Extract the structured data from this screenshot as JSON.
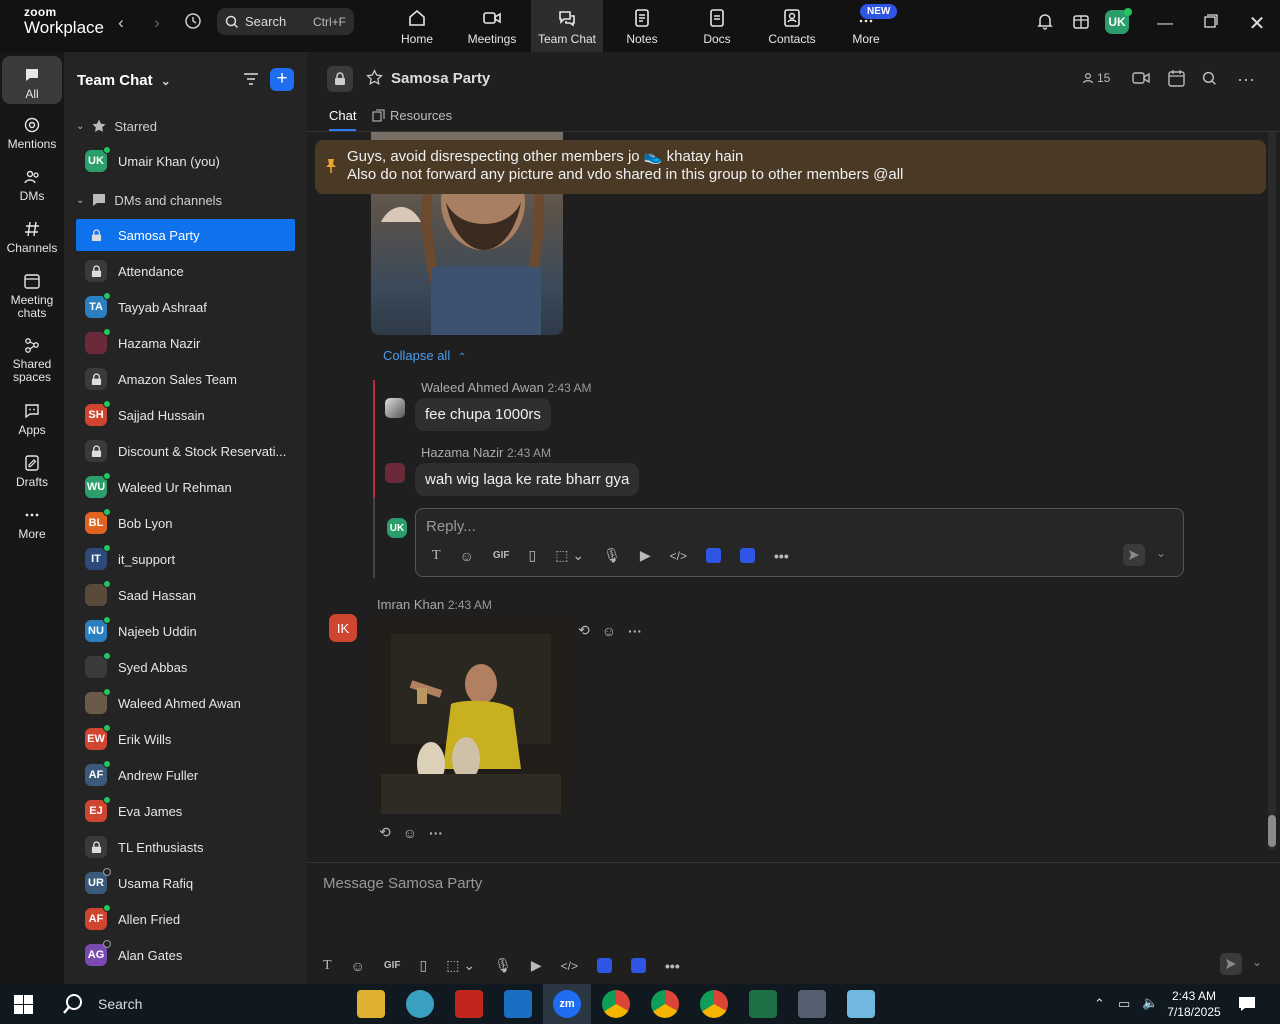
{
  "app": {
    "logo_top": "zoom",
    "logo_bottom": "Workplace"
  },
  "search": {
    "label": "Search",
    "shortcut": "Ctrl+F"
  },
  "top_tabs": [
    {
      "label": "Home"
    },
    {
      "label": "Meetings"
    },
    {
      "label": "Team Chat"
    },
    {
      "label": "Notes"
    },
    {
      "label": "Docs"
    },
    {
      "label": "Contacts"
    },
    {
      "label": "More"
    }
  ],
  "new_badge": "NEW",
  "user_avatar": "UK",
  "rail": [
    {
      "label": "All"
    },
    {
      "label": "Mentions"
    },
    {
      "label": "DMs"
    },
    {
      "label": "Channels"
    },
    {
      "label": "Meeting chats"
    },
    {
      "label": "Shared spaces"
    },
    {
      "label": "Apps"
    },
    {
      "label": "Drafts"
    },
    {
      "label": "More"
    }
  ],
  "sidebar": {
    "title": "Team Chat",
    "starred_label": "Starred",
    "starred_item": {
      "name": "Umair Khan (you)",
      "initials": "UK",
      "color": "#2b9e6b"
    },
    "dms_label": "DMs and channels",
    "items": [
      {
        "name": "Samosa Party",
        "type": "lock",
        "active": true
      },
      {
        "name": "Attendance",
        "type": "lock"
      },
      {
        "name": "Tayyab Ashraaf",
        "initials": "TA",
        "color": "#2b7fc1",
        "online": true
      },
      {
        "name": "Hazama Nazir",
        "initials": "",
        "color": "#6b2a3a",
        "online": true
      },
      {
        "name": "Amazon Sales Team",
        "type": "lock"
      },
      {
        "name": "Sajjad Hussain",
        "initials": "SH",
        "color": "#d0452f",
        "online": true
      },
      {
        "name": "Discount & Stock Reservati...",
        "type": "lock"
      },
      {
        "name": "Waleed Ur Rehman",
        "initials": "WU",
        "color": "#2b9e6b",
        "online": true
      },
      {
        "name": "Bob Lyon",
        "initials": "BL",
        "color": "#e0631f",
        "online": true
      },
      {
        "name": "it_support",
        "initials": "IT",
        "color": "#2c4a7a",
        "online": true
      },
      {
        "name": "Saad Hassan",
        "initials": "",
        "color": "#5a4a3a",
        "online": true
      },
      {
        "name": "Najeeb Uddin",
        "initials": "NU",
        "color": "#2b7fc1",
        "online": true
      },
      {
        "name": "Syed Abbas",
        "initials": "",
        "color": "#3a3a3a",
        "online": true
      },
      {
        "name": "Waleed Ahmed Awan",
        "initials": "",
        "color": "#6a5a4a",
        "online": true
      },
      {
        "name": "Erik Wills",
        "initials": "EW",
        "color": "#d0452f",
        "online": true
      },
      {
        "name": "Andrew Fuller",
        "initials": "AF",
        "color": "#3b5a7a",
        "online": true
      },
      {
        "name": "Eva James",
        "initials": "EJ",
        "color": "#d0452f",
        "online": true
      },
      {
        "name": "TL Enthusiasts",
        "type": "lock"
      },
      {
        "name": "Usama Rafiq",
        "initials": "UR",
        "color": "#3b5a7a",
        "online": false
      },
      {
        "name": "Allen Fried",
        "initials": "AF",
        "color": "#d0452f",
        "online": true
      },
      {
        "name": "Alan Gates",
        "initials": "AG",
        "color": "#7a4ab0",
        "online": false
      }
    ]
  },
  "channel": {
    "name": "Samosa Party",
    "members": "15",
    "tabs": [
      "Chat",
      "Resources"
    ]
  },
  "pinned": {
    "line1": "Guys, avoid disrespecting other members jo 👟 khatay hain",
    "line2": "Also do not forward any picture and vdo shared in this group to other members @all"
  },
  "thread": {
    "collapse_label": "Collapse all",
    "replies": [
      {
        "author": "Waleed Ahmed Awan",
        "time": "2:43 AM",
        "text": "fee chupa 1000rs"
      },
      {
        "author": "Hazama Nazir",
        "time": "2:43 AM",
        "text": "wah wig laga ke rate bharr gya"
      }
    ],
    "reply_placeholder": "Reply...",
    "reply_avatar": "UK"
  },
  "message": {
    "author": "Imran Khan",
    "time": "2:43 AM",
    "initials": "IK"
  },
  "composer": {
    "placeholder": "Message Samosa Party"
  },
  "gif_label": "GIF",
  "taskbar": {
    "search": "Search",
    "time": "2:43 AM",
    "date": "7/18/2025"
  }
}
